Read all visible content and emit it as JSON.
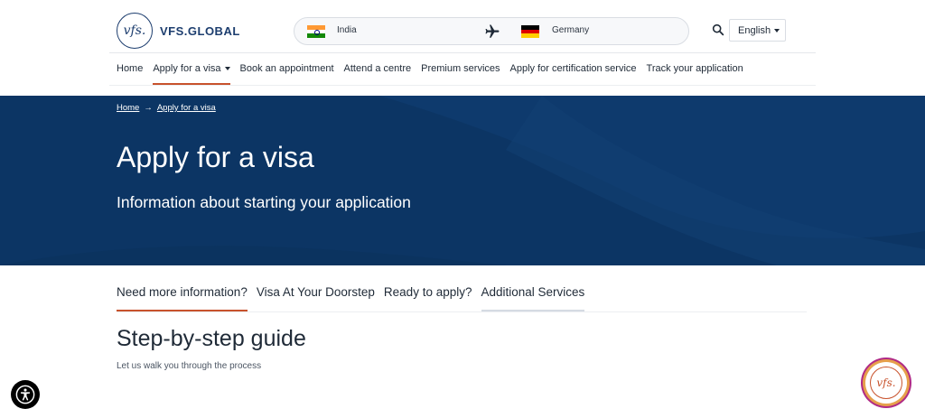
{
  "header": {
    "logo_mark": "vfs.",
    "logo_text": "VFS.GLOBAL",
    "route": {
      "from_country": "India",
      "to_country": "Germany"
    },
    "language": "English"
  },
  "nav": {
    "items": [
      {
        "label": "Home"
      },
      {
        "label": "Apply for a visa",
        "active": true,
        "has_dropdown": true
      },
      {
        "label": "Book an appointment"
      },
      {
        "label": "Attend a centre"
      },
      {
        "label": "Premium services"
      },
      {
        "label": "Apply for certification service"
      },
      {
        "label": "Track your application"
      }
    ]
  },
  "hero": {
    "breadcrumb": [
      "Home",
      "Apply for a visa"
    ],
    "title": "Apply for a visa",
    "subtitle": "Information about starting your application",
    "background_color": "#0c3564"
  },
  "tabs": [
    {
      "label": "Need more information?",
      "active": true
    },
    {
      "label": "Visa At Your Doorstep"
    },
    {
      "label": "Ready to apply?"
    },
    {
      "label": "Additional Services",
      "hovered": true
    }
  ],
  "guide": {
    "title": "Step-by-step guide",
    "subtitle": "Let us walk you through the process"
  },
  "chat_widget": {
    "logo_mark": "vfs."
  },
  "colors": {
    "accent": "#c8522c",
    "brand_navy": "#0c3564"
  }
}
